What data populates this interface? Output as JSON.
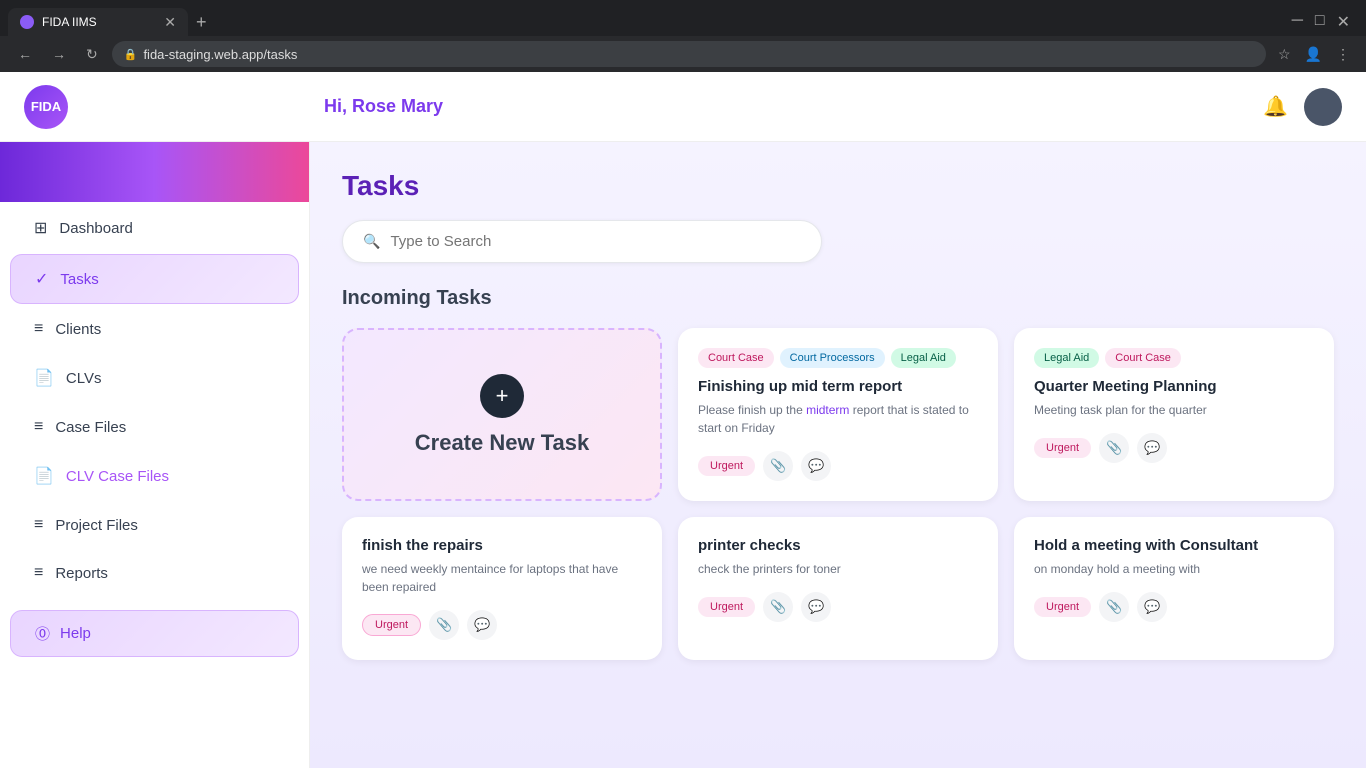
{
  "browser": {
    "tab_title": "FIDA IIMS",
    "tab_favicon": "F",
    "url": "fida-staging.web.app/tasks",
    "new_tab_btn": "+",
    "nav_back": "←",
    "nav_forward": "→",
    "nav_refresh": "↻",
    "nav_home": "⌂",
    "lock_icon": "🔒"
  },
  "header": {
    "logo_text": "FIDA",
    "greeting": "Hi, ",
    "user_name": "Rose Mary",
    "bell_icon": "🔔"
  },
  "sidebar": {
    "items": [
      {
        "id": "dashboard",
        "label": "Dashboard",
        "icon": "⊞",
        "active": false
      },
      {
        "id": "tasks",
        "label": "Tasks",
        "icon": "✓",
        "active": true
      },
      {
        "id": "clients",
        "label": "Clients",
        "icon": "≡",
        "active": false
      },
      {
        "id": "clvs",
        "label": "CLVs",
        "icon": "📄",
        "active": false
      },
      {
        "id": "case-files",
        "label": "Case Files",
        "icon": "≡",
        "active": false
      },
      {
        "id": "clv-case-files",
        "label": "CLV Case Files",
        "icon": "📄",
        "active": false
      },
      {
        "id": "project-files",
        "label": "Project Files",
        "icon": "≡",
        "active": false
      },
      {
        "id": "reports",
        "label": "Reports",
        "icon": "≡",
        "active": false
      }
    ],
    "help_label": "Help",
    "help_icon": "?"
  },
  "page": {
    "title": "Tasks",
    "search_placeholder": "Type to Search",
    "section_title": "Incoming Tasks"
  },
  "tasks": {
    "create_card": {
      "plus": "+",
      "label": "Create New Task"
    },
    "cards": [
      {
        "id": "task1",
        "tags": [
          {
            "label": "Court Case",
            "type": "court-case"
          },
          {
            "label": "Court Processors",
            "type": "court-processors"
          },
          {
            "label": "Legal Aid",
            "type": "legal-aid"
          }
        ],
        "title": "Finishing up mid term report",
        "description": "Please finish up the midterm report that is stated to start on Friday",
        "description_highlight": "midterm",
        "badge": "Urgent",
        "has_attachment": true,
        "has_comment": true
      },
      {
        "id": "task2",
        "tags": [
          {
            "label": "Legal Aid",
            "type": "legal-aid"
          },
          {
            "label": "Court Case",
            "type": "court-case"
          }
        ],
        "title": "Quarter Meeting Planning",
        "description": "Meeting task plan for the quarter",
        "badge": "Urgent",
        "has_attachment": true,
        "has_comment": true
      },
      {
        "id": "task3",
        "tags": [],
        "title": "finish the repairs",
        "description": "we need weekly mentaince for laptops that have been repaired",
        "badge": "Urgent",
        "has_attachment": true,
        "has_comment": true
      },
      {
        "id": "task4",
        "tags": [],
        "title": "printer checks",
        "description": "check the printers for toner",
        "badge": "Urgent",
        "has_attachment": true,
        "has_comment": true
      },
      {
        "id": "task5",
        "tags": [],
        "title": "Hold a meeting with Consultant",
        "description": "on monday hold a meeting with",
        "badge": "Urgent",
        "has_attachment": true,
        "has_comment": true
      }
    ]
  },
  "icons": {
    "search": "🔍",
    "attachment": "📎",
    "comment": "💬",
    "help": "⓪",
    "circle_check": "✓"
  }
}
